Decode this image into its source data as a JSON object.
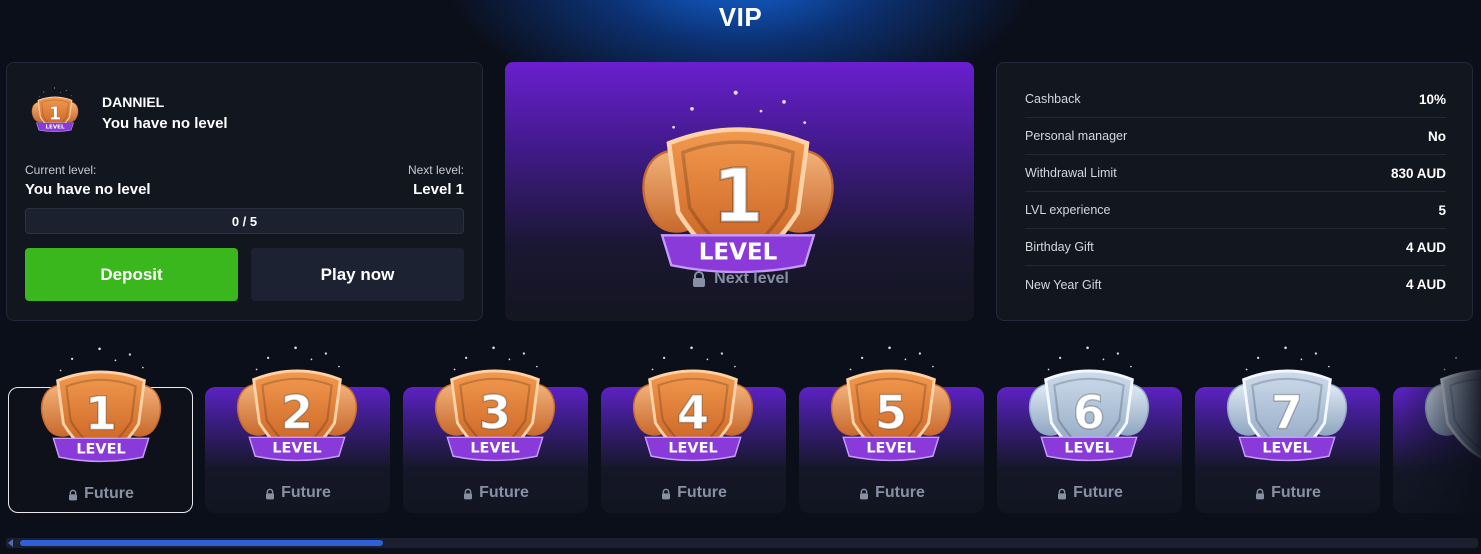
{
  "page": {
    "title": "VIP"
  },
  "user": {
    "name": "DANNIEL",
    "level_text": "You have no level",
    "badge_number": "1",
    "badge_label": "LEVEL"
  },
  "progress": {
    "current_label": "Current level:",
    "current_value": "You have no level",
    "next_label": "Next level:",
    "next_value": "Level 1",
    "text": "0 / 5",
    "fraction": 0
  },
  "buttons": {
    "deposit": "Deposit",
    "play": "Play now"
  },
  "featured": {
    "number": "1",
    "label": "LEVEL",
    "status": "Next level"
  },
  "stats": [
    {
      "label": "Cashback",
      "value": "10%"
    },
    {
      "label": "Personal manager",
      "value": "No"
    },
    {
      "label": "Withdrawal Limit",
      "value": "830 AUD"
    },
    {
      "label": "LVL experience",
      "value": "5"
    },
    {
      "label": "Birthday Gift",
      "value": "4 AUD"
    },
    {
      "label": "New Year Gift",
      "value": "4 AUD"
    }
  ],
  "levels": [
    {
      "number": "1",
      "label": "LEVEL",
      "status": "Future",
      "tier": "bronze"
    },
    {
      "number": "2",
      "label": "LEVEL",
      "status": "Future",
      "tier": "bronze"
    },
    {
      "number": "3",
      "label": "LEVEL",
      "status": "Future",
      "tier": "bronze"
    },
    {
      "number": "4",
      "label": "LEVEL",
      "status": "Future",
      "tier": "bronze"
    },
    {
      "number": "5",
      "label": "LEVEL",
      "status": "Future",
      "tier": "bronze"
    },
    {
      "number": "6",
      "label": "LEVEL",
      "status": "Future",
      "tier": "silver"
    },
    {
      "number": "7",
      "label": "LEVEL",
      "status": "Future",
      "tier": "silver"
    },
    {
      "number": "",
      "label": "",
      "status": "",
      "tier": "silver"
    }
  ],
  "colors": {
    "accent_green": "#39b71c",
    "accent_purple": "#6a1fd0",
    "bronze": "#e0813c",
    "silver": "#b8cbe0",
    "scroll_thumb": "#2e5fd8"
  }
}
